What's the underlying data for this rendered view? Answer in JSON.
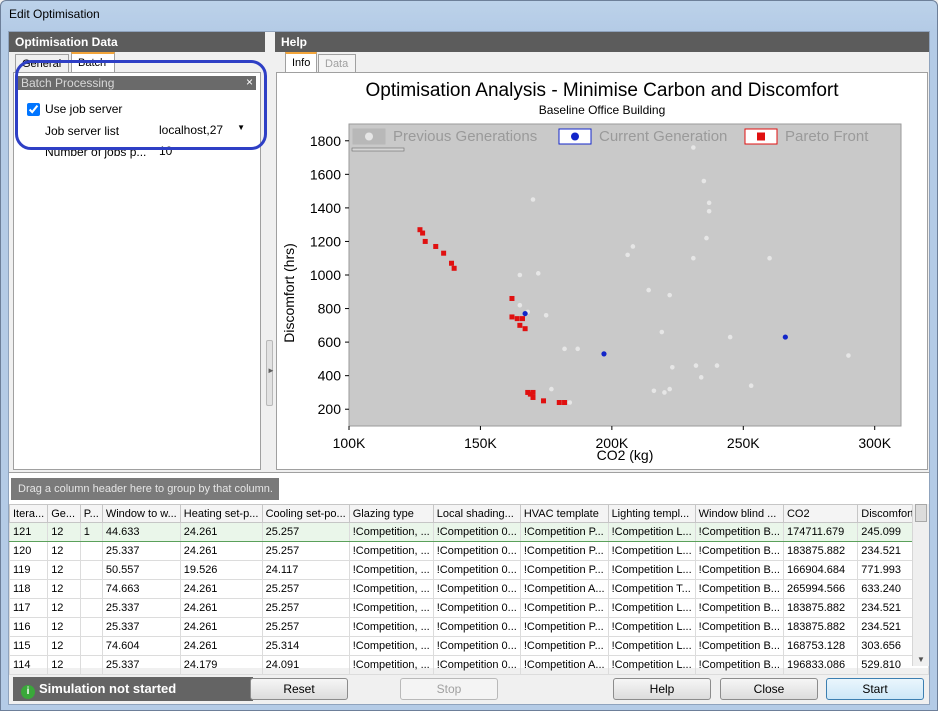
{
  "window": {
    "title": "Edit Optimisation"
  },
  "left": {
    "header": "Optimisation Data",
    "tabs": [
      {
        "label": "General"
      },
      {
        "label": "Batch"
      }
    ],
    "group_title": "Batch Processing",
    "use_job_server": {
      "label": "Use job server",
      "checked": true
    },
    "job_server_list": {
      "label": "Job server list",
      "value": "localhost,27"
    },
    "num_jobs": {
      "label": "Number of jobs p...",
      "value": "10"
    }
  },
  "help": {
    "header": "Help",
    "tabs": [
      {
        "label": "Info"
      },
      {
        "label": "Data"
      }
    ]
  },
  "chart_data": {
    "type": "scatter",
    "title": "Optimisation Analysis - Minimise Carbon and Discomfort",
    "subtitle": "Baseline Office Building",
    "xlabel": "CO2 (kg)",
    "ylabel": "Discomfort (hrs)",
    "xlim": [
      100000,
      310000
    ],
    "ylim": [
      100,
      1900
    ],
    "xticks": [
      "100K",
      "150K",
      "200K",
      "250K",
      "300K"
    ],
    "yticks": [
      "200",
      "400",
      "600",
      "800",
      "1000",
      "1200",
      "1400",
      "1600",
      "1800"
    ],
    "legend_position": "top",
    "series": [
      {
        "name": "Previous Generations",
        "color": "#e6e6e6",
        "points": [
          [
            165000,
            1000
          ],
          [
            170000,
            1450
          ],
          [
            172000,
            1010
          ],
          [
            175000,
            760
          ],
          [
            165000,
            820
          ],
          [
            177000,
            320
          ],
          [
            182000,
            560
          ],
          [
            184000,
            240
          ],
          [
            187000,
            560
          ],
          [
            206000,
            1120
          ],
          [
            208000,
            1170
          ],
          [
            214000,
            910
          ],
          [
            216000,
            310
          ],
          [
            219000,
            660
          ],
          [
            220000,
            300
          ],
          [
            222000,
            320
          ],
          [
            222000,
            880
          ],
          [
            223000,
            450
          ],
          [
            231000,
            1760
          ],
          [
            231000,
            1100
          ],
          [
            232000,
            460
          ],
          [
            234000,
            390
          ],
          [
            235000,
            1560
          ],
          [
            236000,
            1220
          ],
          [
            237000,
            1430
          ],
          [
            237000,
            1380
          ],
          [
            240000,
            460
          ],
          [
            245000,
            630
          ],
          [
            253000,
            340
          ],
          [
            260000,
            1100
          ],
          [
            290000,
            520
          ],
          [
            168000,
            780
          ]
        ]
      },
      {
        "name": "Current Generation",
        "color": "#1326c9",
        "points": [
          [
            167000,
            770
          ],
          [
            197000,
            530
          ],
          [
            266000,
            630
          ]
        ]
      },
      {
        "name": "Pareto Front",
        "color": "#e01010",
        "points": [
          [
            127000,
            1270
          ],
          [
            128000,
            1250
          ],
          [
            129000,
            1200
          ],
          [
            133000,
            1170
          ],
          [
            136000,
            1130
          ],
          [
            139000,
            1070
          ],
          [
            140000,
            1040
          ],
          [
            162000,
            860
          ],
          [
            162000,
            750
          ],
          [
            164000,
            740
          ],
          [
            165000,
            700
          ],
          [
            166000,
            740
          ],
          [
            167000,
            680
          ],
          [
            168000,
            300
          ],
          [
            169000,
            290
          ],
          [
            170000,
            270
          ],
          [
            170000,
            300
          ],
          [
            174000,
            250
          ],
          [
            180000,
            240
          ],
          [
            182000,
            240
          ]
        ]
      }
    ]
  },
  "grid": {
    "group_hint": "Drag a column header here to group by that column.",
    "columns": [
      "Itera...",
      "Ge...",
      "P...",
      "Window to w...",
      "Heating set-p...",
      "Cooling set-po...",
      "Glazing type",
      "Local shading...",
      "HVAC template",
      "Lighting templ...",
      "Window blind ...",
      "CO2",
      "Discomfort"
    ],
    "rows": [
      [
        "121",
        "12",
        "1",
        "44.633",
        "24.261",
        "25.257",
        "!Competition, ...",
        "!Competition 0...",
        "!Competition P...",
        "!Competition L...",
        "!Competition B...",
        "174711.679",
        "245.099"
      ],
      [
        "120",
        "12",
        "",
        "25.337",
        "24.261",
        "25.257",
        "!Competition, ...",
        "!Competition 0...",
        "!Competition P...",
        "!Competition L...",
        "!Competition B...",
        "183875.882",
        "234.521"
      ],
      [
        "119",
        "12",
        "",
        "50.557",
        "19.526",
        "24.117",
        "!Competition, ...",
        "!Competition 0...",
        "!Competition P...",
        "!Competition L...",
        "!Competition B...",
        "166904.684",
        "771.993"
      ],
      [
        "118",
        "12",
        "",
        "74.663",
        "24.261",
        "25.257",
        "!Competition, ...",
        "!Competition 0...",
        "!Competition A...",
        "!Competition T...",
        "!Competition B...",
        "265994.566",
        "633.240"
      ],
      [
        "117",
        "12",
        "",
        "25.337",
        "24.261",
        "25.257",
        "!Competition, ...",
        "!Competition 0...",
        "!Competition P...",
        "!Competition L...",
        "!Competition B...",
        "183875.882",
        "234.521"
      ],
      [
        "116",
        "12",
        "",
        "25.337",
        "24.261",
        "25.257",
        "!Competition, ...",
        "!Competition 0...",
        "!Competition P...",
        "!Competition L...",
        "!Competition B...",
        "183875.882",
        "234.521"
      ],
      [
        "115",
        "12",
        "",
        "74.604",
        "24.261",
        "25.314",
        "!Competition, ...",
        "!Competition 0...",
        "!Competition P...",
        "!Competition L...",
        "!Competition B...",
        "168753.128",
        "303.656"
      ],
      [
        "114",
        "12",
        "",
        "25.337",
        "24.179",
        "24.091",
        "!Competition, ...",
        "!Competition 0...",
        "!Competition A...",
        "!Competition L...",
        "!Competition B...",
        "196833.086",
        "529.810"
      ]
    ]
  },
  "status": {
    "text": "Simulation not started"
  },
  "buttons": {
    "reset": "Reset",
    "stop": "Stop",
    "help": "Help",
    "close": "Close",
    "start": "Start"
  }
}
